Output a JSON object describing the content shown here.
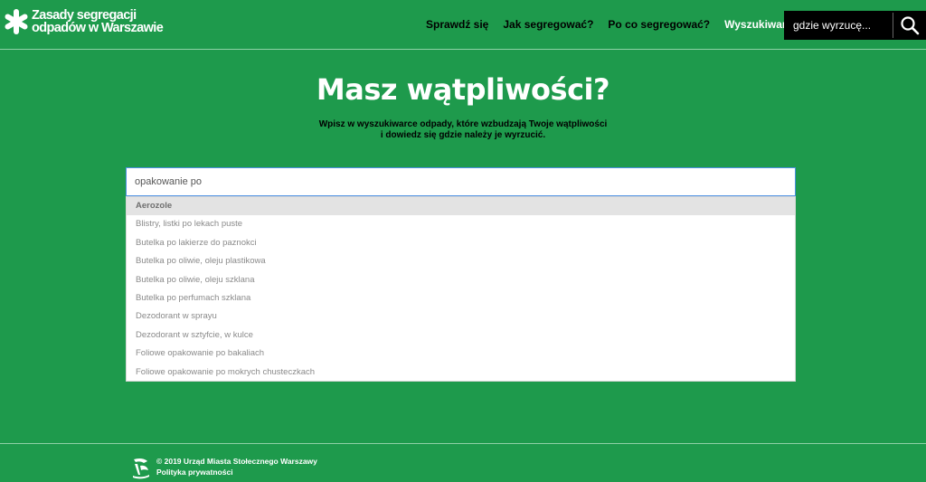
{
  "brand": {
    "line1": "Zasady segregacji",
    "line2": "odpadów w Warszawie",
    "icon": "asterisk-icon"
  },
  "nav": {
    "items": [
      {
        "label": "Sprawdź się",
        "active": false
      },
      {
        "label": "Jak segregować?",
        "active": false
      },
      {
        "label": "Po co segregować?",
        "active": false
      },
      {
        "label": "Wyszukiwarka",
        "active": true
      }
    ]
  },
  "header_search": {
    "placeholder": "gdzie wyrzucę...",
    "icon": "search-icon"
  },
  "hero": {
    "title": "Masz wątpliwości?",
    "subtitle_line1": "Wpisz w wyszukiwarce odpady, które wzbudzają Twoje wątpliwości",
    "subtitle_line2": "i dowiedz się gdzie należy je wyrzucić."
  },
  "search": {
    "value": "opakowanie po"
  },
  "suggestions": [
    "Aerozole",
    "Blistry, listki po lekach puste",
    "Butelka po lakierze do paznokci",
    "Butelka po oliwie, oleju plastikowa",
    "Butelka po oliwie, oleju szklana",
    "Butelka po perfumach szklana",
    "Dezodorant w sprayu",
    "Dezodorant w sztyfcie, w kulce",
    "Foliowe opakowanie po bakaliach",
    "Foliowe opakowanie po mokrych chusteczkach"
  ],
  "footer": {
    "copyright": "© 2019 Urząd Miasta Stołecznego Warszawy",
    "privacy": "Polityka prywatności"
  },
  "colors": {
    "background": "#1e9a4c",
    "search_box": "#000000",
    "input_focus_border": "#4a90e2",
    "highlight_row": "#e3e3e3"
  }
}
